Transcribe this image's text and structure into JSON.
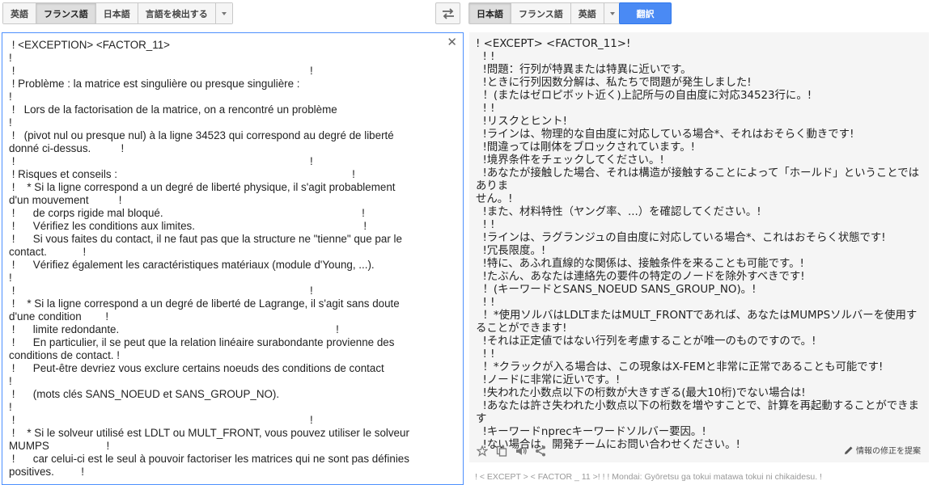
{
  "source_langs": {
    "items": [
      "英語",
      "フランス語",
      "日本語",
      "言語を検出する"
    ],
    "selected_index": 1
  },
  "target_langs": {
    "items": [
      "日本語",
      "フランス語",
      "英語"
    ],
    "selected_index": 0
  },
  "translate_button": "翻訳",
  "source_text": " ! <EXCEPTION> <FACTOR_11>\n!\n !                                                                                                  !\n ! Problème : la matrice est singulière ou presque singulière :\n!\n !   Lors de la factorisation de la matrice, on a rencontré un problème\n!\n !   (pivot nul ou presque nul) à la ligne 34523 qui correspond au degré de liberté\ndonné ci-dessus.          !\n !                                                                                                  !\n ! Risques et conseils :                                                                              !\n !    * Si la ligne correspond a un degré de liberté physique, il s'agit probablement\nd'un mouvement          !\n !      de corps rigide mal bloqué.                                                                  !\n !      Vérifiez les conditions aux limites.                                                        !\n !      Si vous faites du contact, il ne faut pas que la structure ne \"tienne\" que par le\ncontact.            !\n !      Vérifiez également les caractéristiques matériaux (module d'Young, ...).\n!\n !                                                                                                  !\n !    * Si la ligne correspond a un degré de liberté de Lagrange, il s'agit sans doute\nd'une condition        !\n !      limite redondante.                                                                        !\n !      En particulier, il se peut que la relation linéaire surabondante provienne des\nconditions de contact. !\n !      Peut-être devriez vous exclure certains noeuds des conditions de contact\n!\n !      (mots clés SANS_NOEUD et SANS_GROUP_NO).\n!\n !                                                                                                  !\n !    * Si le solveur utilisé est LDLT ou MULT_FRONT, vous pouvez utiliser le solveur\nMUMPS                   !\n !      car celui-ci est le seul à pouvoir factoriser les matrices qui ne sont pas définies\npositives.         !",
  "target_text": "! <EXCEPT> <FACTOR_11>!\n  ! !\n  !問題：行列が特異または特異に近いです。\n  !ときに行列因数分解は、私たちで問題が発生しました!\n  ！(またはゼロピボット近く)上記所与の自由度に対応34523行に。!\n  ! !\n  !リスクとヒント!\n  !ラインは、物理的な自由度に対応している場合*、それはおそらく動きです!\n  !間違っては剛体をブロックされています。!\n  !境界条件をチェックしてください。!\n  !あなたが接触した場合、それは構造が接触することによって「ホールド」ということではありま\nせん。!\n  !また、材料特性（ヤング率、...）を確認してください。!\n  ! !\n  !ラインは、ラグランジュの自由度に対応している場合*、これはおそらく状態です!\n  !冗長限度。!\n  !特に、あふれ直線的な関係は、接触条件を来ることも可能です。!\n  !たぶん、あなたは連絡先の要件の特定のノードを除外すべきです!\n  ！(キーワードとSANS_NOEUD SANS_GROUP_NO)。!\n  ! !\n  ！*使用ソルバはLDLTまたはMULT_FRONTであれば、あなたはMUMPSソルバーを使用す\nることができます!\n  !それは正定値ではない行列を考慮することが唯一のものですので。!\n  ! !\n  ！*クラックが入る場合は、この現象はX-FEMと非常に正常であることも可能です!\n  !ノードに非常に近いです。!\n  !失われた小数点以下の桁数が大きすぎる(最大10桁)でない場合は!\n  !あなたは許さ失われた小数点以下の桁数を増やすことで、計算を再起動することができます\n  !キーワードnprecキーワードソルバー要因。!\n  !ない場合は、開発チームにお問い合わせください。!",
  "suggest_edit": "情報の修正を提案",
  "romanized_text": "! < EXCEPT > < FACTOR _ 11 >! ! ! Mondai: Gyōretsu ga tokui matawa tokui ni chikaidesu. !",
  "colors": {
    "accent": "#4a8af4",
    "focus_border": "#4d90fe",
    "target_bg": "#f5f5f5"
  }
}
